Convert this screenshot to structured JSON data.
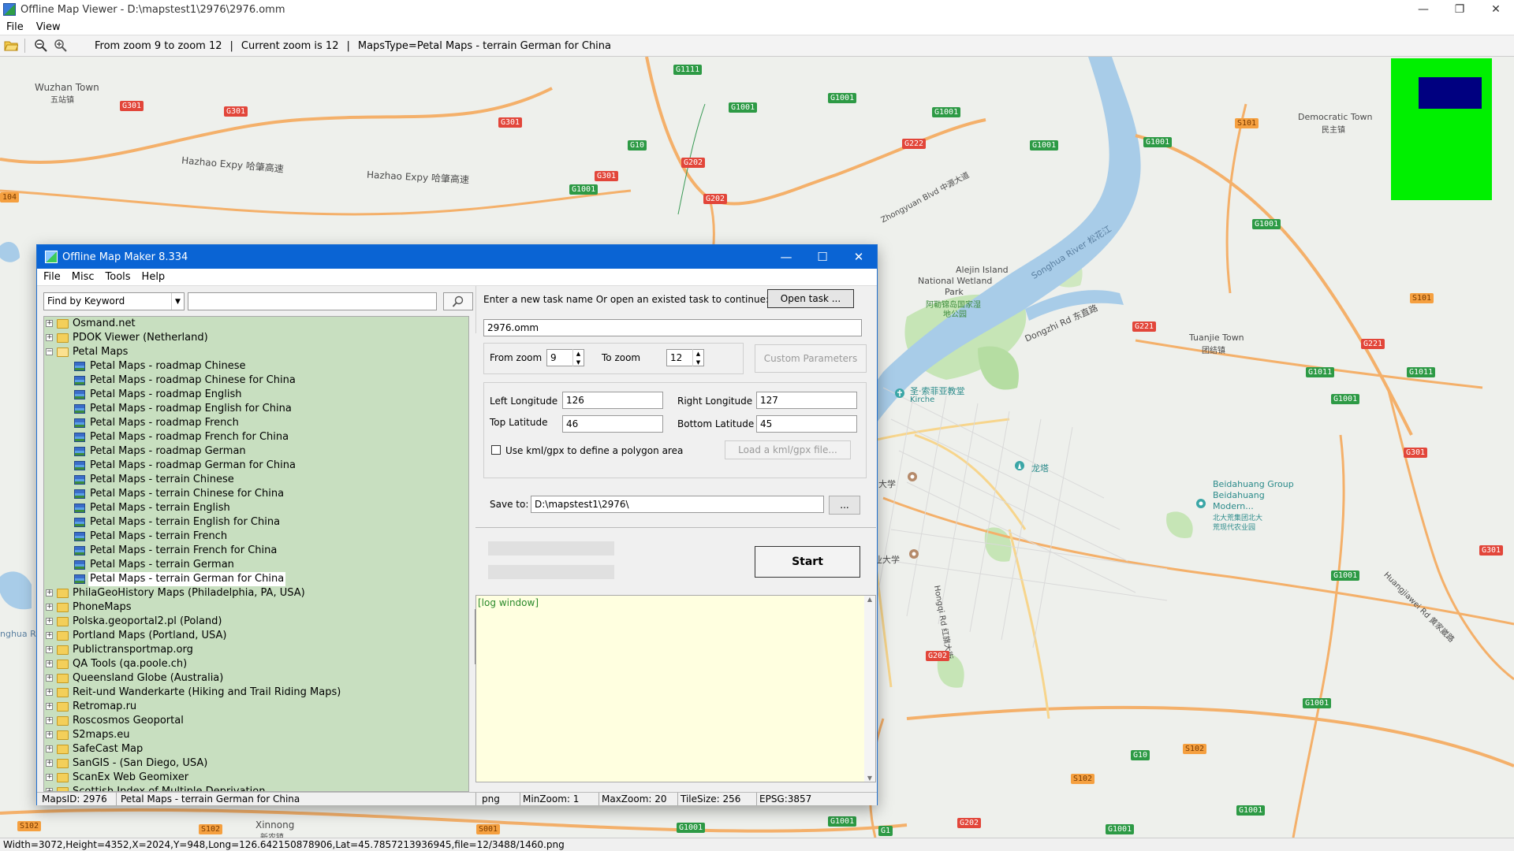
{
  "viewer": {
    "title": "Offline Map Viewer - D:\\mapstest1\\2976\\2976.omm",
    "controls": {
      "minimize": "—",
      "restore": "❐",
      "close": "✕"
    },
    "menu": [
      "File",
      "View"
    ],
    "toolbar_info": {
      "zoom_range": "From zoom 9 to zoom 12",
      "sep1": "|",
      "current_zoom": "Current zoom is 12",
      "sep2": "|",
      "maps_type": "MapsType=Petal Maps - terrain German for China"
    },
    "status": "Width=3072,Height=4352,X=2024,Y=948,Long=126.642150878906,Lat=45.7857213936945,file=12/3488/1460.png"
  },
  "map": {
    "colors": {
      "background": "#eef0ec",
      "water": "#a8cce8",
      "park": "#c6e5b6",
      "road_orange": "#f4b06a",
      "road_yellow": "#f7d58c",
      "minimap": "#00f000",
      "minimap_view": "#000080"
    },
    "labels": [
      {
        "id": "wuzhan",
        "text": "Wuzhan Town"
      },
      {
        "id": "wuzhan_cn",
        "text": "五站镇"
      },
      {
        "id": "hazhao1",
        "text": "Hazhao Expy 哈肇高速"
      },
      {
        "id": "hazhao2",
        "text": "Hazhao Expy 哈肇高速"
      },
      {
        "id": "zhongyuan",
        "text": "Zhongyuan Blvd 中源大道"
      },
      {
        "id": "democratic",
        "text": "Democratic Town"
      },
      {
        "id": "democratic_cn",
        "text": "民主镇"
      },
      {
        "id": "alejin",
        "text": "Alejin Island"
      },
      {
        "id": "wetland",
        "text": "National Wetland"
      },
      {
        "id": "park",
        "text": "Park"
      },
      {
        "id": "park_cn1",
        "text": "阿勒锦岛国家湿"
      },
      {
        "id": "park_cn2",
        "text": "地公园"
      },
      {
        "id": "songhua",
        "text": "Songhua River 松花江"
      },
      {
        "id": "dongzhi",
        "text": "Dongzhi Rd 东直路"
      },
      {
        "id": "tuanjie",
        "text": "Tuanjie Town"
      },
      {
        "id": "tuanjie_cn",
        "text": "团结镇"
      },
      {
        "id": "sophia",
        "text": "圣·索菲亚教堂"
      },
      {
        "id": "kirche",
        "text": "Kirche"
      },
      {
        "id": "longta",
        "text": "龙塔"
      },
      {
        "id": "beidahuang1",
        "text": "Beidahuang Group"
      },
      {
        "id": "beidahuang2",
        "text": "Beidahuang"
      },
      {
        "id": "beidahuang3",
        "text": "Modern..."
      },
      {
        "id": "beidahuang_cn1",
        "text": "北大荒集团北大"
      },
      {
        "id": "beidahuang_cn2",
        "text": "荒现代农业园"
      },
      {
        "id": "daxue1",
        "text": "大学"
      },
      {
        "id": "daxue2",
        "text": "业大学"
      },
      {
        "id": "xinnong",
        "text": "Xinnong"
      },
      {
        "id": "xinnong_cn",
        "text": "新农镇"
      },
      {
        "id": "hongqi",
        "text": "Hongqi Rd 红旗大街"
      },
      {
        "id": "huangjiawei",
        "text": "Huangjiawei Rd 黄家崴路"
      },
      {
        "id": "songhua_left",
        "text": "nghua Ri"
      }
    ],
    "shields": [
      {
        "text": "G301",
        "color": "red"
      },
      {
        "text": "G301",
        "color": "red"
      },
      {
        "text": "G301",
        "color": "red"
      },
      {
        "text": "G301",
        "color": "red"
      },
      {
        "text": "G1111",
        "color": "green"
      },
      {
        "text": "G1001",
        "color": "green"
      },
      {
        "text": "G1001",
        "color": "green"
      },
      {
        "text": "G1001",
        "color": "green"
      },
      {
        "text": "G1001",
        "color": "green"
      },
      {
        "text": "G1001",
        "color": "green"
      },
      {
        "text": "G10",
        "color": "green"
      },
      {
        "text": "G202",
        "color": "red"
      },
      {
        "text": "G222",
        "color": "red"
      },
      {
        "text": "G1001",
        "color": "green"
      },
      {
        "text": "G202",
        "color": "red"
      },
      {
        "text": "S101",
        "color": "orange"
      },
      {
        "text": "G1001",
        "color": "green"
      },
      {
        "text": "S101",
        "color": "orange"
      },
      {
        "text": "G221",
        "color": "red"
      },
      {
        "text": "G221",
        "color": "red"
      },
      {
        "text": "G1011",
        "color": "green"
      },
      {
        "text": "G1011",
        "color": "green"
      },
      {
        "text": "G1001",
        "color": "green"
      },
      {
        "text": "G301",
        "color": "red"
      },
      {
        "text": "G1001",
        "color": "green"
      },
      {
        "text": "G301",
        "color": "red"
      },
      {
        "text": "G202",
        "color": "red"
      },
      {
        "text": "G1001",
        "color": "green"
      },
      {
        "text": "G10",
        "color": "green"
      },
      {
        "text": "S102",
        "color": "orange"
      },
      {
        "text": "G1001",
        "color": "green"
      },
      {
        "text": "G1001",
        "color": "green"
      },
      {
        "text": "G1001",
        "color": "green"
      },
      {
        "text": "G202",
        "color": "red"
      },
      {
        "text": "S001",
        "color": "orange"
      },
      {
        "text": "S102",
        "color": "orange"
      },
      {
        "text": "S102",
        "color": "orange"
      },
      {
        "text": "G1",
        "color": "green"
      },
      {
        "text": "G1001",
        "color": "green"
      },
      {
        "text": "S102",
        "color": "orange"
      },
      {
        "text": "104",
        "color": "orange"
      }
    ]
  },
  "dialog": {
    "title": "Offline Map Maker 8.334",
    "controls": {
      "minimize": "—",
      "maximize": "☐",
      "close": "✕"
    },
    "menu": [
      "File",
      "Misc",
      "Tools",
      "Help"
    ],
    "search": {
      "mode": "Find by Keyword",
      "keyword": ""
    },
    "tree": [
      {
        "label": "Osmand.net",
        "level": 0,
        "type": "folder",
        "expanded": false
      },
      {
        "label": "PDOK Viewer (Netherland)",
        "level": 0,
        "type": "folder",
        "expanded": false
      },
      {
        "label": "Petal Maps",
        "level": 0,
        "type": "folder",
        "expanded": true
      },
      {
        "label": "Petal Maps - roadmap Chinese",
        "level": 1,
        "type": "map"
      },
      {
        "label": "Petal Maps - roadmap Chinese for China",
        "level": 1,
        "type": "map"
      },
      {
        "label": "Petal Maps - roadmap English",
        "level": 1,
        "type": "map"
      },
      {
        "label": "Petal Maps - roadmap English for China",
        "level": 1,
        "type": "map"
      },
      {
        "label": "Petal Maps - roadmap French",
        "level": 1,
        "type": "map"
      },
      {
        "label": "Petal Maps - roadmap French for China",
        "level": 1,
        "type": "map"
      },
      {
        "label": "Petal Maps - roadmap German",
        "level": 1,
        "type": "map"
      },
      {
        "label": "Petal Maps - roadmap German for China",
        "level": 1,
        "type": "map"
      },
      {
        "label": "Petal Maps - terrain Chinese",
        "level": 1,
        "type": "map"
      },
      {
        "label": "Petal Maps - terrain Chinese for China",
        "level": 1,
        "type": "map"
      },
      {
        "label": "Petal Maps - terrain English",
        "level": 1,
        "type": "map"
      },
      {
        "label": "Petal Maps - terrain English for China",
        "level": 1,
        "type": "map"
      },
      {
        "label": "Petal Maps - terrain French",
        "level": 1,
        "type": "map"
      },
      {
        "label": "Petal Maps - terrain French for China",
        "level": 1,
        "type": "map"
      },
      {
        "label": "Petal Maps - terrain German",
        "level": 1,
        "type": "map"
      },
      {
        "label": "Petal Maps - terrain German for China",
        "level": 1,
        "type": "map",
        "selected": true
      },
      {
        "label": "PhilaGeoHistory Maps (Philadelphia, PA, USA)",
        "level": 0,
        "type": "folder",
        "expanded": false
      },
      {
        "label": "PhoneMaps",
        "level": 0,
        "type": "folder",
        "expanded": false
      },
      {
        "label": "Polska.geoportal2.pl (Poland)",
        "level": 0,
        "type": "folder",
        "expanded": false
      },
      {
        "label": "Portland Maps (Portland, USA)",
        "level": 0,
        "type": "folder",
        "expanded": false
      },
      {
        "label": "Publictransportmap.org",
        "level": 0,
        "type": "folder",
        "expanded": false
      },
      {
        "label": "QA Tools (qa.poole.ch)",
        "level": 0,
        "type": "folder",
        "expanded": false
      },
      {
        "label": "Queensland Globe (Australia)",
        "level": 0,
        "type": "folder",
        "expanded": false
      },
      {
        "label": "Reit-und Wanderkarte (Hiking and Trail Riding Maps)",
        "level": 0,
        "type": "folder",
        "expanded": false
      },
      {
        "label": "Retromap.ru",
        "level": 0,
        "type": "folder",
        "expanded": false
      },
      {
        "label": "Roscosmos Geoportal",
        "level": 0,
        "type": "folder",
        "expanded": false
      },
      {
        "label": "S2maps.eu",
        "level": 0,
        "type": "folder",
        "expanded": false
      },
      {
        "label": "SafeCast Map",
        "level": 0,
        "type": "folder",
        "expanded": false
      },
      {
        "label": "SanGIS - (San Diego, USA)",
        "level": 0,
        "type": "folder",
        "expanded": false
      },
      {
        "label": "ScanEx Web Geomixer",
        "level": 0,
        "type": "folder",
        "expanded": false
      },
      {
        "label": "Scottish Index of Multiple Deprivation",
        "level": 0,
        "type": "folder",
        "expanded": false
      }
    ],
    "task": {
      "prompt": "Enter a new task name Or open an existed task to continue:",
      "open_button": "Open task ...",
      "name": "2976.omm",
      "from_zoom_label": "From zoom",
      "from_zoom": "9",
      "to_zoom_label": "To zoom",
      "to_zoom": "12",
      "custom_params": "Custom Parameters",
      "left_lon_label": "Left Longitude",
      "left_lon": "126",
      "right_lon_label": "Right Longitude",
      "right_lon": "127",
      "top_lat_label": "Top Latitude",
      "top_lat": "46",
      "bottom_lat_label": "Bottom Latitude",
      "bottom_lat": "45",
      "kml_label": "Use kml/gpx to define a polygon area",
      "kml_checked": false,
      "load_kml": "Load a kml/gpx file...",
      "save_label": "Save to:",
      "save_path": "D:\\mapstest1\\2976\\",
      "browse": "...",
      "start": "Start",
      "log": "[log window]"
    },
    "status": {
      "maps_id": "MapsID: 2976",
      "maps_name": "Petal Maps - terrain German for China",
      "format": "png",
      "min_zoom": "MinZoom: 1",
      "max_zoom": "MaxZoom: 20",
      "tile_size": "TileSize: 256",
      "epsg": "EPSG:3857"
    }
  }
}
